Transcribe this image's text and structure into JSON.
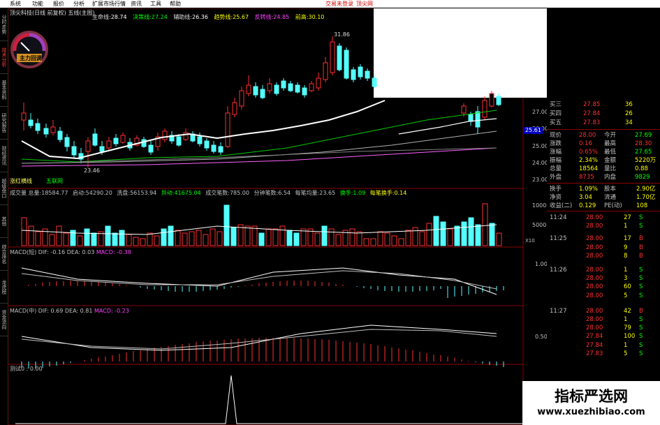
{
  "menu": {
    "items": [
      "系统",
      "功能",
      "报价",
      "分析",
      "扩展市场行情",
      "资讯",
      "工具",
      "帮助"
    ],
    "right_items": [
      "交易未登录",
      "顶尖网"
    ]
  },
  "left_tabs": [
    "分时走势",
    "技术分析",
    "基本资料",
    "研究报告",
    "财经资讯",
    "超级盘口",
    "其他",
    "综合排名",
    "龙虎榜",
    "资金流向"
  ],
  "main_chart": {
    "title": "顶尖科技(日线 前复权)",
    "indicator": "五线(主图)",
    "legend": [
      {
        "name": "生命线:",
        "value": "28.74",
        "color": "#ffffff"
      },
      {
        "name": "决策线:",
        "value": "27.24",
        "color": "#00ff00"
      },
      {
        "name": "辅助线:",
        "value": "26.36",
        "color": "#ffffff"
      },
      {
        "name": "趋势线:",
        "value": "25.67",
        "color": "#ffff00"
      },
      {
        "name": "反转线:",
        "value": "24.85",
        "color": "#ff40ff"
      },
      {
        "name": "前高:",
        "value": "30.10",
        "color": "#ffff00"
      }
    ],
    "y_ticks": [
      "27.00",
      "26.00",
      "25.00",
      "24.00",
      "23.00"
    ],
    "current_price_tag": "25.61",
    "high_label": "31.86",
    "low_label": "23.46",
    "gauge_label": "主力回调",
    "bottom_labels": [
      "涨红横线",
      "五联网"
    ]
  },
  "volume_panel": {
    "header": [
      {
        "text": "成交量 总量:",
        "value": "18584.77"
      },
      {
        "text": "启动:",
        "value": "54290.20"
      },
      {
        "text": "洗盘:",
        "value": "56153.94"
      },
      {
        "text": "异动:",
        "value": "41675.04"
      },
      {
        "text": "成交笔数:",
        "value": "785.00"
      },
      {
        "text": "分钟笔数:",
        "value": "6.54"
      },
      {
        "text": "每笔均量:",
        "value": "23.65"
      },
      {
        "text": "换手:",
        "value": "1.09"
      },
      {
        "text": "每笔换手:",
        "value": "0.14"
      }
    ],
    "y_ticks": [
      "10000",
      "5000",
      "X10"
    ]
  },
  "macd_short": {
    "header": "MACD(短) DIF: -0.16",
    "dea": "DEA: 0.03",
    "macd": "MACD: -0.38",
    "y_tick": "1.00"
  },
  "macd_mid": {
    "header": "MACD(中) DIF: 0.69",
    "dea": "DEA: 0.81",
    "macd": "MACD: -0.23",
    "y_tick": "0.50"
  },
  "test_panel": {
    "header": "测试0 : 0.00"
  },
  "quote": {
    "asks": [
      {
        "label": "买三",
        "price": "27.85",
        "vol": "36"
      },
      {
        "label": "买四",
        "price": "27.84",
        "vol": "26"
      },
      {
        "label": "买五",
        "price": "27.83",
        "vol": "34"
      }
    ],
    "stats": [
      {
        "l1": "现价",
        "v1": "28.00",
        "l2": "今开",
        "v2": "27.69"
      },
      {
        "l1": "涨跌",
        "v1": "0.16",
        "l2": "最高",
        "v2": "28.30"
      },
      {
        "l1": "涨幅",
        "v1": "0.65%",
        "l2": "最低",
        "v2": "27.65"
      },
      {
        "l1": "振幅",
        "v1": "2.34%",
        "l2": "金额",
        "v2": "5220万"
      },
      {
        "l1": "总量",
        "v1": "18564",
        "l2": "量比",
        "v2": "0.88"
      },
      {
        "l1": "外盘",
        "v1": "8735",
        "l2": "内盘",
        "v2": "9829"
      }
    ],
    "stats2": [
      {
        "l1": "换手",
        "v1": "1.09%",
        "l2": "股本",
        "v2": "2.90亿"
      },
      {
        "l1": "净资",
        "v1": "3.04",
        "l2": "流通",
        "v2": "1.70亿"
      },
      {
        "l1": "收益(二)",
        "v1": "0.129",
        "l2": "PE(动)",
        "v2": "108"
      }
    ],
    "ticks": [
      {
        "time": "11:24",
        "price": "28.00",
        "vol": "27",
        "side": "S"
      },
      {
        "time": "",
        "price": "28.00",
        "vol": "1",
        "side": "S"
      },
      {
        "time": "11:25",
        "price": "28.00",
        "vol": "17",
        "side": "B"
      },
      {
        "time": "",
        "price": "28.00",
        "vol": "9",
        "side": "B"
      },
      {
        "time": "",
        "price": "28.00",
        "vol": "8",
        "side": "B"
      },
      {
        "time": "11:26",
        "price": "28.00",
        "vol": "1",
        "side": "S"
      },
      {
        "time": "",
        "price": "28.00",
        "vol": "3",
        "side": "S"
      },
      {
        "time": "",
        "price": "28.00",
        "vol": "60",
        "side": "S"
      },
      {
        "time": "",
        "price": "28.00",
        "vol": "5",
        "side": "S"
      },
      {
        "time": "11:27",
        "price": "28.00",
        "vol": "42",
        "side": "B"
      },
      {
        "time": "",
        "price": "28.00",
        "vol": "1",
        "side": "S"
      },
      {
        "time": "",
        "price": "28.00",
        "vol": "79",
        "side": "S"
      },
      {
        "time": "",
        "price": "27.84",
        "vol": "100",
        "side": "S"
      },
      {
        "time": "",
        "price": "27.84",
        "vol": "1",
        "side": "S"
      },
      {
        "time": "",
        "price": "27.83",
        "vol": "5",
        "side": "S"
      }
    ]
  },
  "watermark": {
    "line1": "指标严选网",
    "line2": "www.xuezhibiao.com"
  },
  "colors": {
    "up": "#ff3030",
    "down": "#54ffff",
    "frame": "#8b0000",
    "bg": "#000000"
  }
}
